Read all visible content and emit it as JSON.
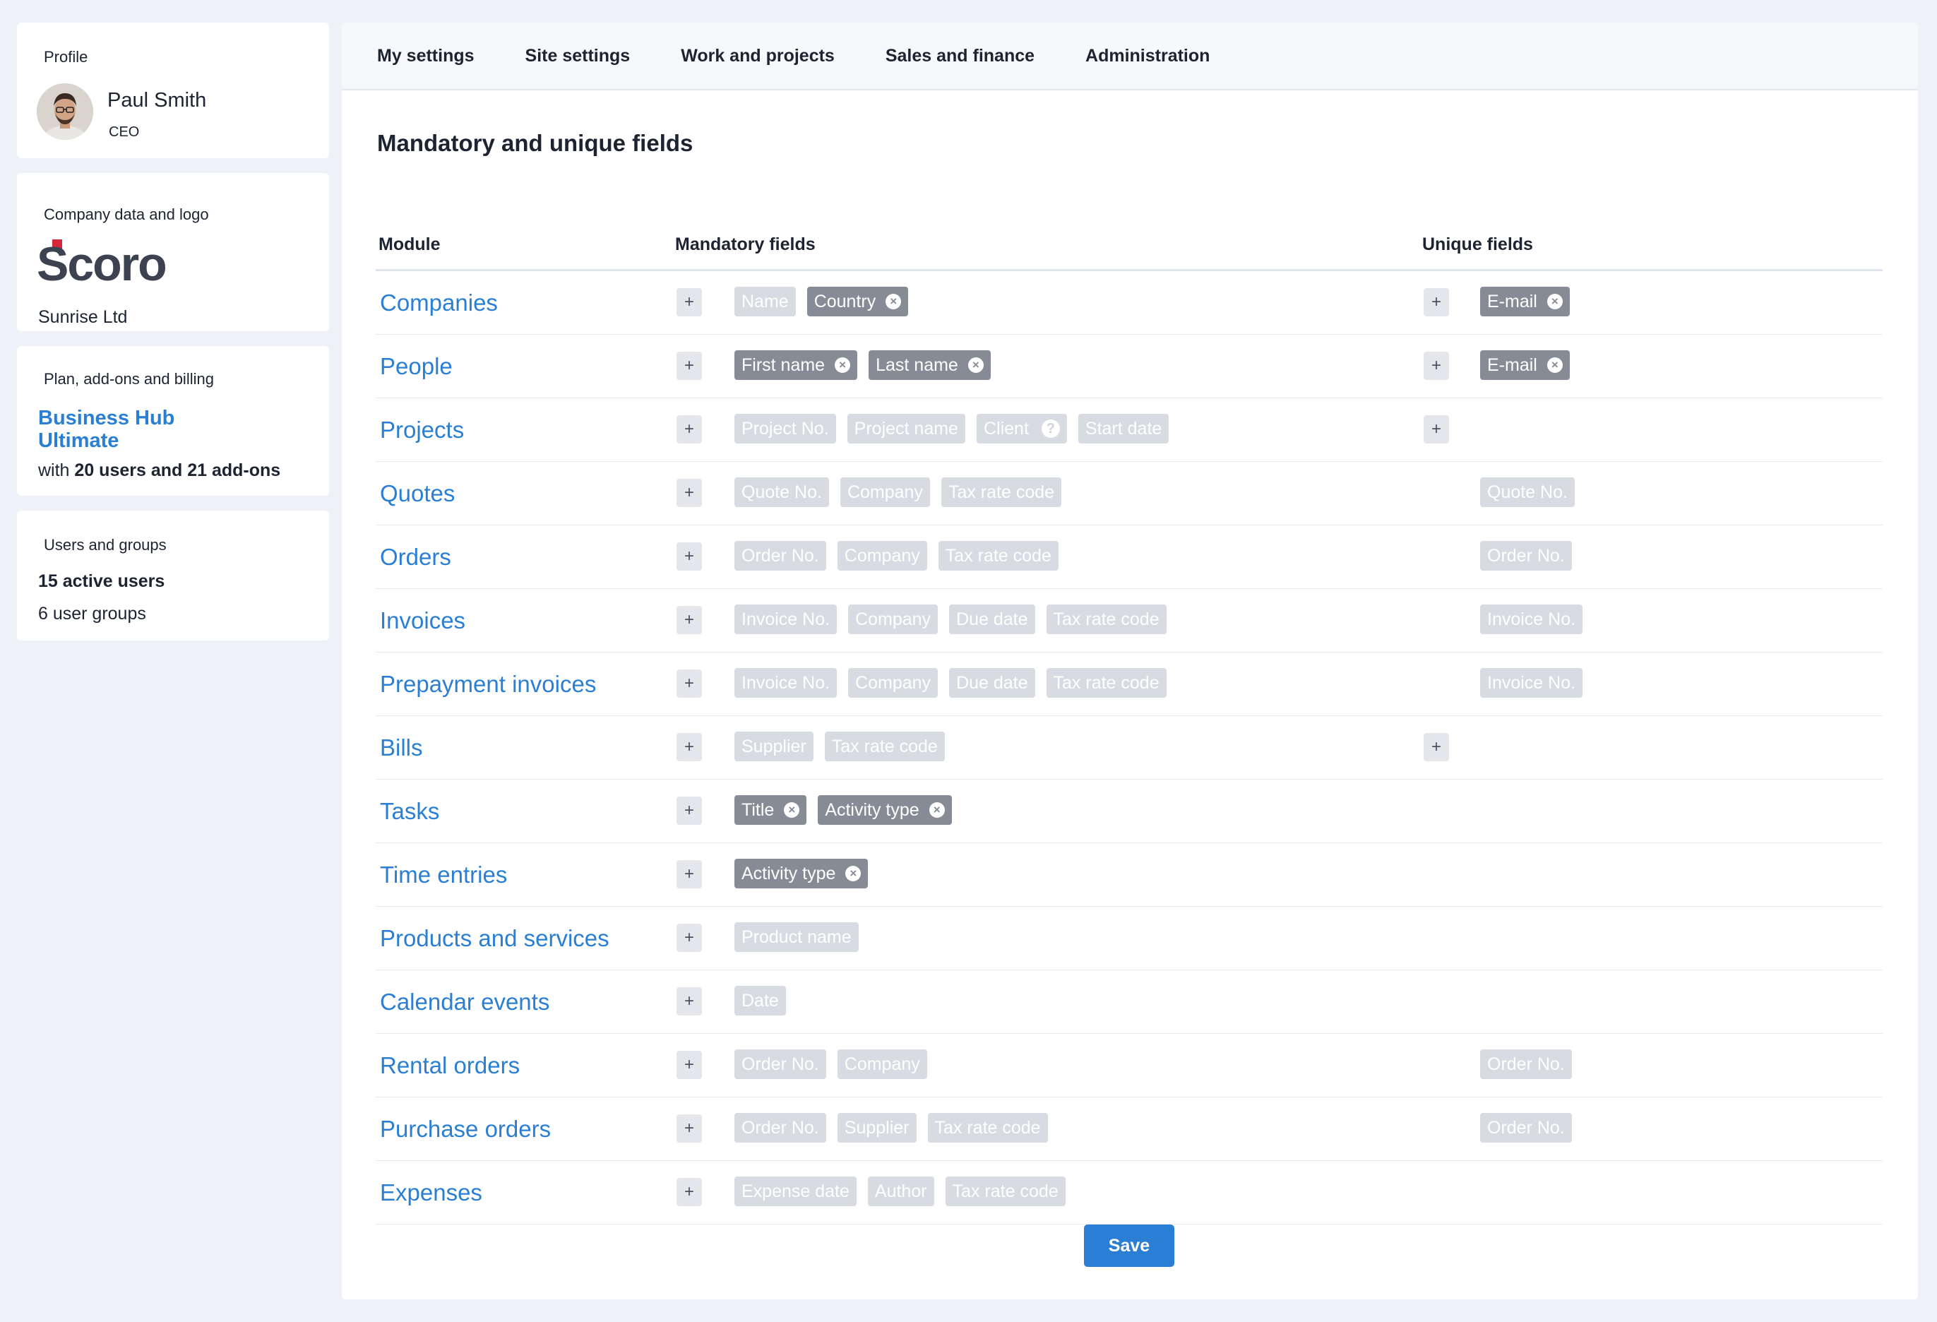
{
  "sidebar": {
    "profile": {
      "label": "Profile",
      "name": "Paul Smith",
      "role": "CEO"
    },
    "company": {
      "label": "Company data and logo",
      "logo_text": "Scoro",
      "name": "Sunrise Ltd"
    },
    "plan": {
      "label": "Plan, add-ons and billing",
      "name": "Business Hub Ultimate",
      "detail_prefix": "with",
      "detail_bold": "20 users and 21 add-ons"
    },
    "users": {
      "label": "Users and groups",
      "active": "15 active users",
      "groups": "6 user groups"
    }
  },
  "tabs": [
    "My settings",
    "Site settings",
    "Work and projects",
    "Sales and finance",
    "Administration"
  ],
  "page_title": "Mandatory and unique fields",
  "table": {
    "headers": {
      "module": "Module",
      "mandatory": "Mandatory fields",
      "unique": "Unique fields"
    },
    "rows": [
      {
        "module": "Companies",
        "unique_add": true,
        "mandatory": [
          {
            "label": "Name",
            "style": "light"
          },
          {
            "label": "Country",
            "style": "dark",
            "removable": true
          }
        ],
        "unique": [
          {
            "label": "E-mail",
            "style": "dark",
            "removable": true
          }
        ]
      },
      {
        "module": "People",
        "unique_add": true,
        "mandatory": [
          {
            "label": "First name",
            "style": "dark",
            "removable": true
          },
          {
            "label": "Last name",
            "style": "dark",
            "removable": true
          }
        ],
        "unique": [
          {
            "label": "E-mail",
            "style": "dark",
            "removable": true
          }
        ]
      },
      {
        "module": "Projects",
        "unique_add": true,
        "mandatory": [
          {
            "label": "Project No.",
            "style": "light"
          },
          {
            "label": "Project name",
            "style": "light"
          },
          {
            "label": "Client",
            "style": "light",
            "help": true
          },
          {
            "label": "Start date",
            "style": "light"
          }
        ],
        "unique": []
      },
      {
        "module": "Quotes",
        "unique_add": false,
        "mandatory": [
          {
            "label": "Quote No.",
            "style": "light"
          },
          {
            "label": "Company",
            "style": "light"
          },
          {
            "label": "Tax rate code",
            "style": "light"
          }
        ],
        "unique": [
          {
            "label": "Quote No.",
            "style": "light"
          }
        ]
      },
      {
        "module": "Orders",
        "unique_add": false,
        "mandatory": [
          {
            "label": "Order No.",
            "style": "light"
          },
          {
            "label": "Company",
            "style": "light"
          },
          {
            "label": "Tax rate code",
            "style": "light"
          }
        ],
        "unique": [
          {
            "label": "Order No.",
            "style": "light"
          }
        ]
      },
      {
        "module": "Invoices",
        "unique_add": false,
        "mandatory": [
          {
            "label": "Invoice No.",
            "style": "light"
          },
          {
            "label": "Company",
            "style": "light"
          },
          {
            "label": "Due date",
            "style": "light"
          },
          {
            "label": "Tax rate code",
            "style": "light"
          }
        ],
        "unique": [
          {
            "label": "Invoice No.",
            "style": "light"
          }
        ]
      },
      {
        "module": "Prepayment invoices",
        "unique_add": false,
        "mandatory": [
          {
            "label": "Invoice No.",
            "style": "light"
          },
          {
            "label": "Company",
            "style": "light"
          },
          {
            "label": "Due date",
            "style": "light"
          },
          {
            "label": "Tax rate code",
            "style": "light"
          }
        ],
        "unique": [
          {
            "label": "Invoice No.",
            "style": "light"
          }
        ]
      },
      {
        "module": "Bills",
        "unique_add": true,
        "mandatory": [
          {
            "label": "Supplier",
            "style": "light"
          },
          {
            "label": "Tax rate code",
            "style": "light"
          }
        ],
        "unique": []
      },
      {
        "module": "Tasks",
        "unique_add": false,
        "mandatory": [
          {
            "label": "Title",
            "style": "dark",
            "removable": true
          },
          {
            "label": "Activity type",
            "style": "dark",
            "removable": true
          }
        ],
        "unique": []
      },
      {
        "module": "Time entries",
        "unique_add": false,
        "mandatory": [
          {
            "label": "Activity type",
            "style": "dark",
            "removable": true
          }
        ],
        "unique": []
      },
      {
        "module": "Products and services",
        "unique_add": false,
        "mandatory": [
          {
            "label": "Product name",
            "style": "light"
          }
        ],
        "unique": []
      },
      {
        "module": "Calendar events",
        "unique_add": false,
        "mandatory": [
          {
            "label": "Date",
            "style": "light"
          }
        ],
        "unique": []
      },
      {
        "module": "Rental orders",
        "unique_add": false,
        "mandatory": [
          {
            "label": "Order No.",
            "style": "light"
          },
          {
            "label": "Company",
            "style": "light"
          }
        ],
        "unique": [
          {
            "label": "Order No.",
            "style": "light"
          }
        ]
      },
      {
        "module": "Purchase orders",
        "unique_add": false,
        "mandatory": [
          {
            "label": "Order No.",
            "style": "light"
          },
          {
            "label": "Supplier",
            "style": "light"
          },
          {
            "label": "Tax rate code",
            "style": "light"
          }
        ],
        "unique": [
          {
            "label": "Order No.",
            "style": "light"
          }
        ]
      },
      {
        "module": "Expenses",
        "unique_add": false,
        "mandatory": [
          {
            "label": "Expense date",
            "style": "light"
          },
          {
            "label": "Author",
            "style": "light"
          },
          {
            "label": "Tax rate code",
            "style": "light"
          }
        ],
        "unique": []
      }
    ]
  },
  "icons": {
    "add": "plus-icon",
    "remove": "close-circle-icon",
    "help": "question-circle-icon"
  },
  "glyphs": {
    "add": "+",
    "remove": "×",
    "help": "?"
  },
  "save_label": "Save",
  "colors": {
    "accent": "#2a7fd4",
    "chip_light": "#d8dbe2",
    "chip_dark": "#868b95"
  }
}
